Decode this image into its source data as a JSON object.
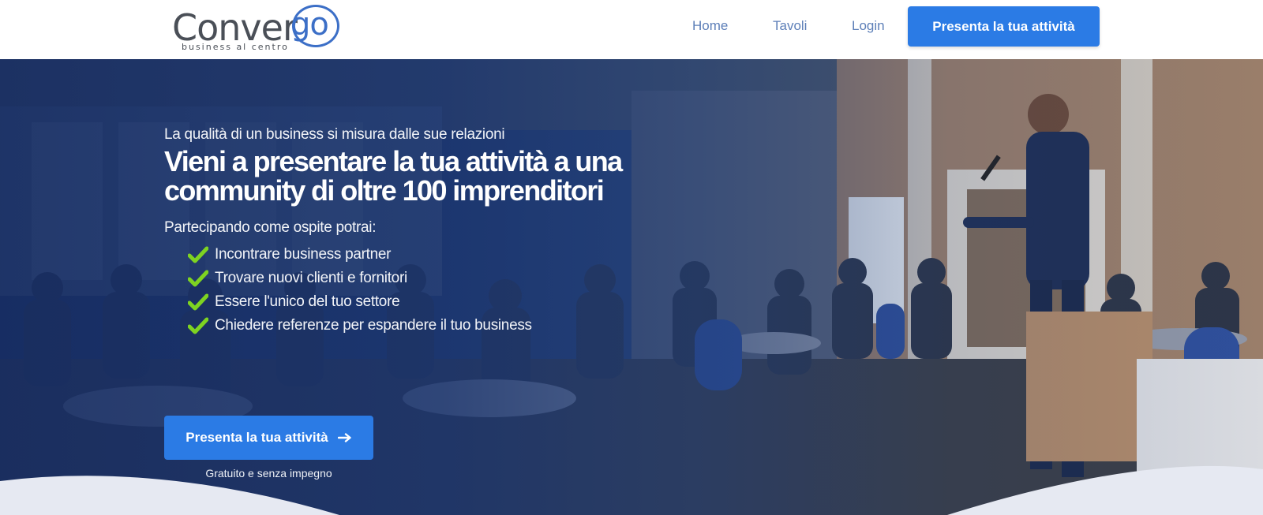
{
  "brand": {
    "logo_main": "Conver",
    "logo_accent": "go",
    "tagline": "business al centro",
    "accent_color": "#3c6fc7"
  },
  "nav": {
    "items": [
      {
        "label": "Home"
      },
      {
        "label": "Tavoli"
      },
      {
        "label": "Login"
      }
    ],
    "cta_label": "Presenta la tua attività"
  },
  "hero": {
    "eyebrow": "La qualità di un business si misura dalle sue relazioni",
    "headline": "Vieni a presentare la tua attività a una community di oltre 100 imprenditori",
    "intro": "Partecipando come ospite potrai:",
    "benefits": [
      {
        "text": "Incontrare business partner",
        "icon": "check-icon"
      },
      {
        "text": "Trovare nuovi clienti e fornitori",
        "icon": "check-icon"
      },
      {
        "text": "Essere l'unico del tuo settore",
        "icon": "check-icon"
      },
      {
        "text": "Chiedere referenze per espandere il tuo business",
        "icon": "check-icon"
      }
    ],
    "cta_label": "Presenta la tua attività",
    "cta_icon": "arrow-right-icon",
    "cta_note": "Gratuito e senza impegno"
  },
  "colors": {
    "primary_button": "#2b7be5",
    "nav_link": "#5d7fb8",
    "check": "#7ed321"
  }
}
